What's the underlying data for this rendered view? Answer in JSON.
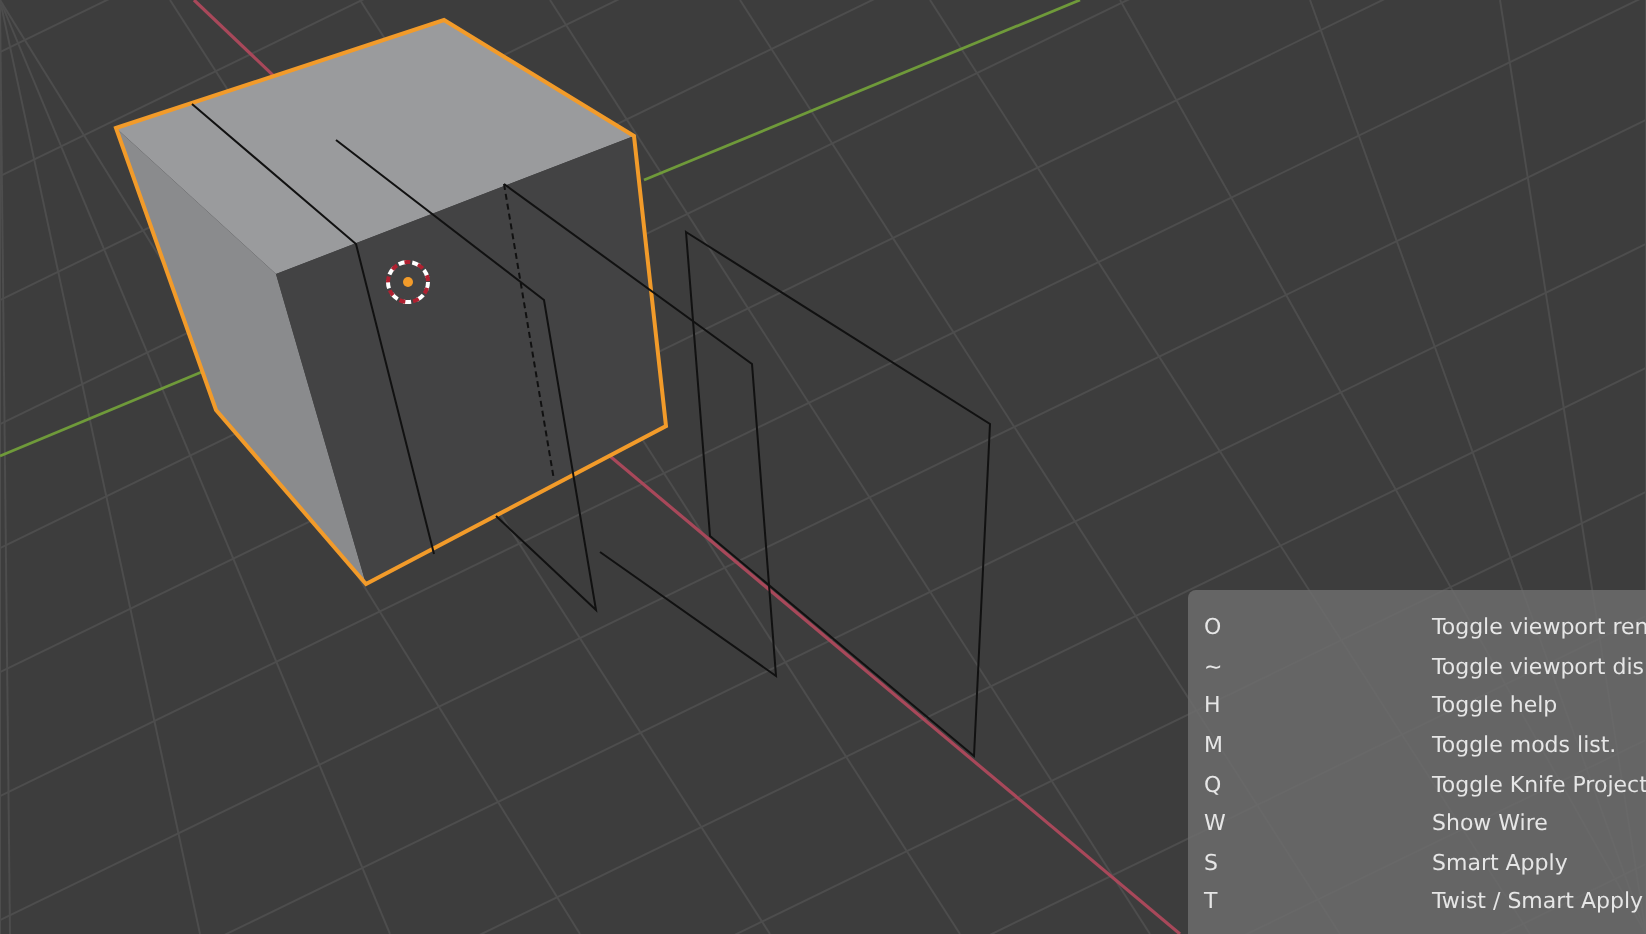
{
  "shortcut_overlay": {
    "rows": [
      {
        "key": "O",
        "action": "Toggle viewport ren"
      },
      {
        "key": "~",
        "action": "Toggle viewport dis"
      },
      {
        "key": "H",
        "action": "Toggle help"
      },
      {
        "key": "M",
        "action": "Toggle mods list."
      },
      {
        "key": "Q",
        "action": "Toggle Knife Project"
      },
      {
        "key": "W",
        "action": "Show Wire"
      },
      {
        "key": "S",
        "action": "Smart Apply"
      },
      {
        "key": "T",
        "action": "Twist / Smart Apply"
      }
    ]
  }
}
